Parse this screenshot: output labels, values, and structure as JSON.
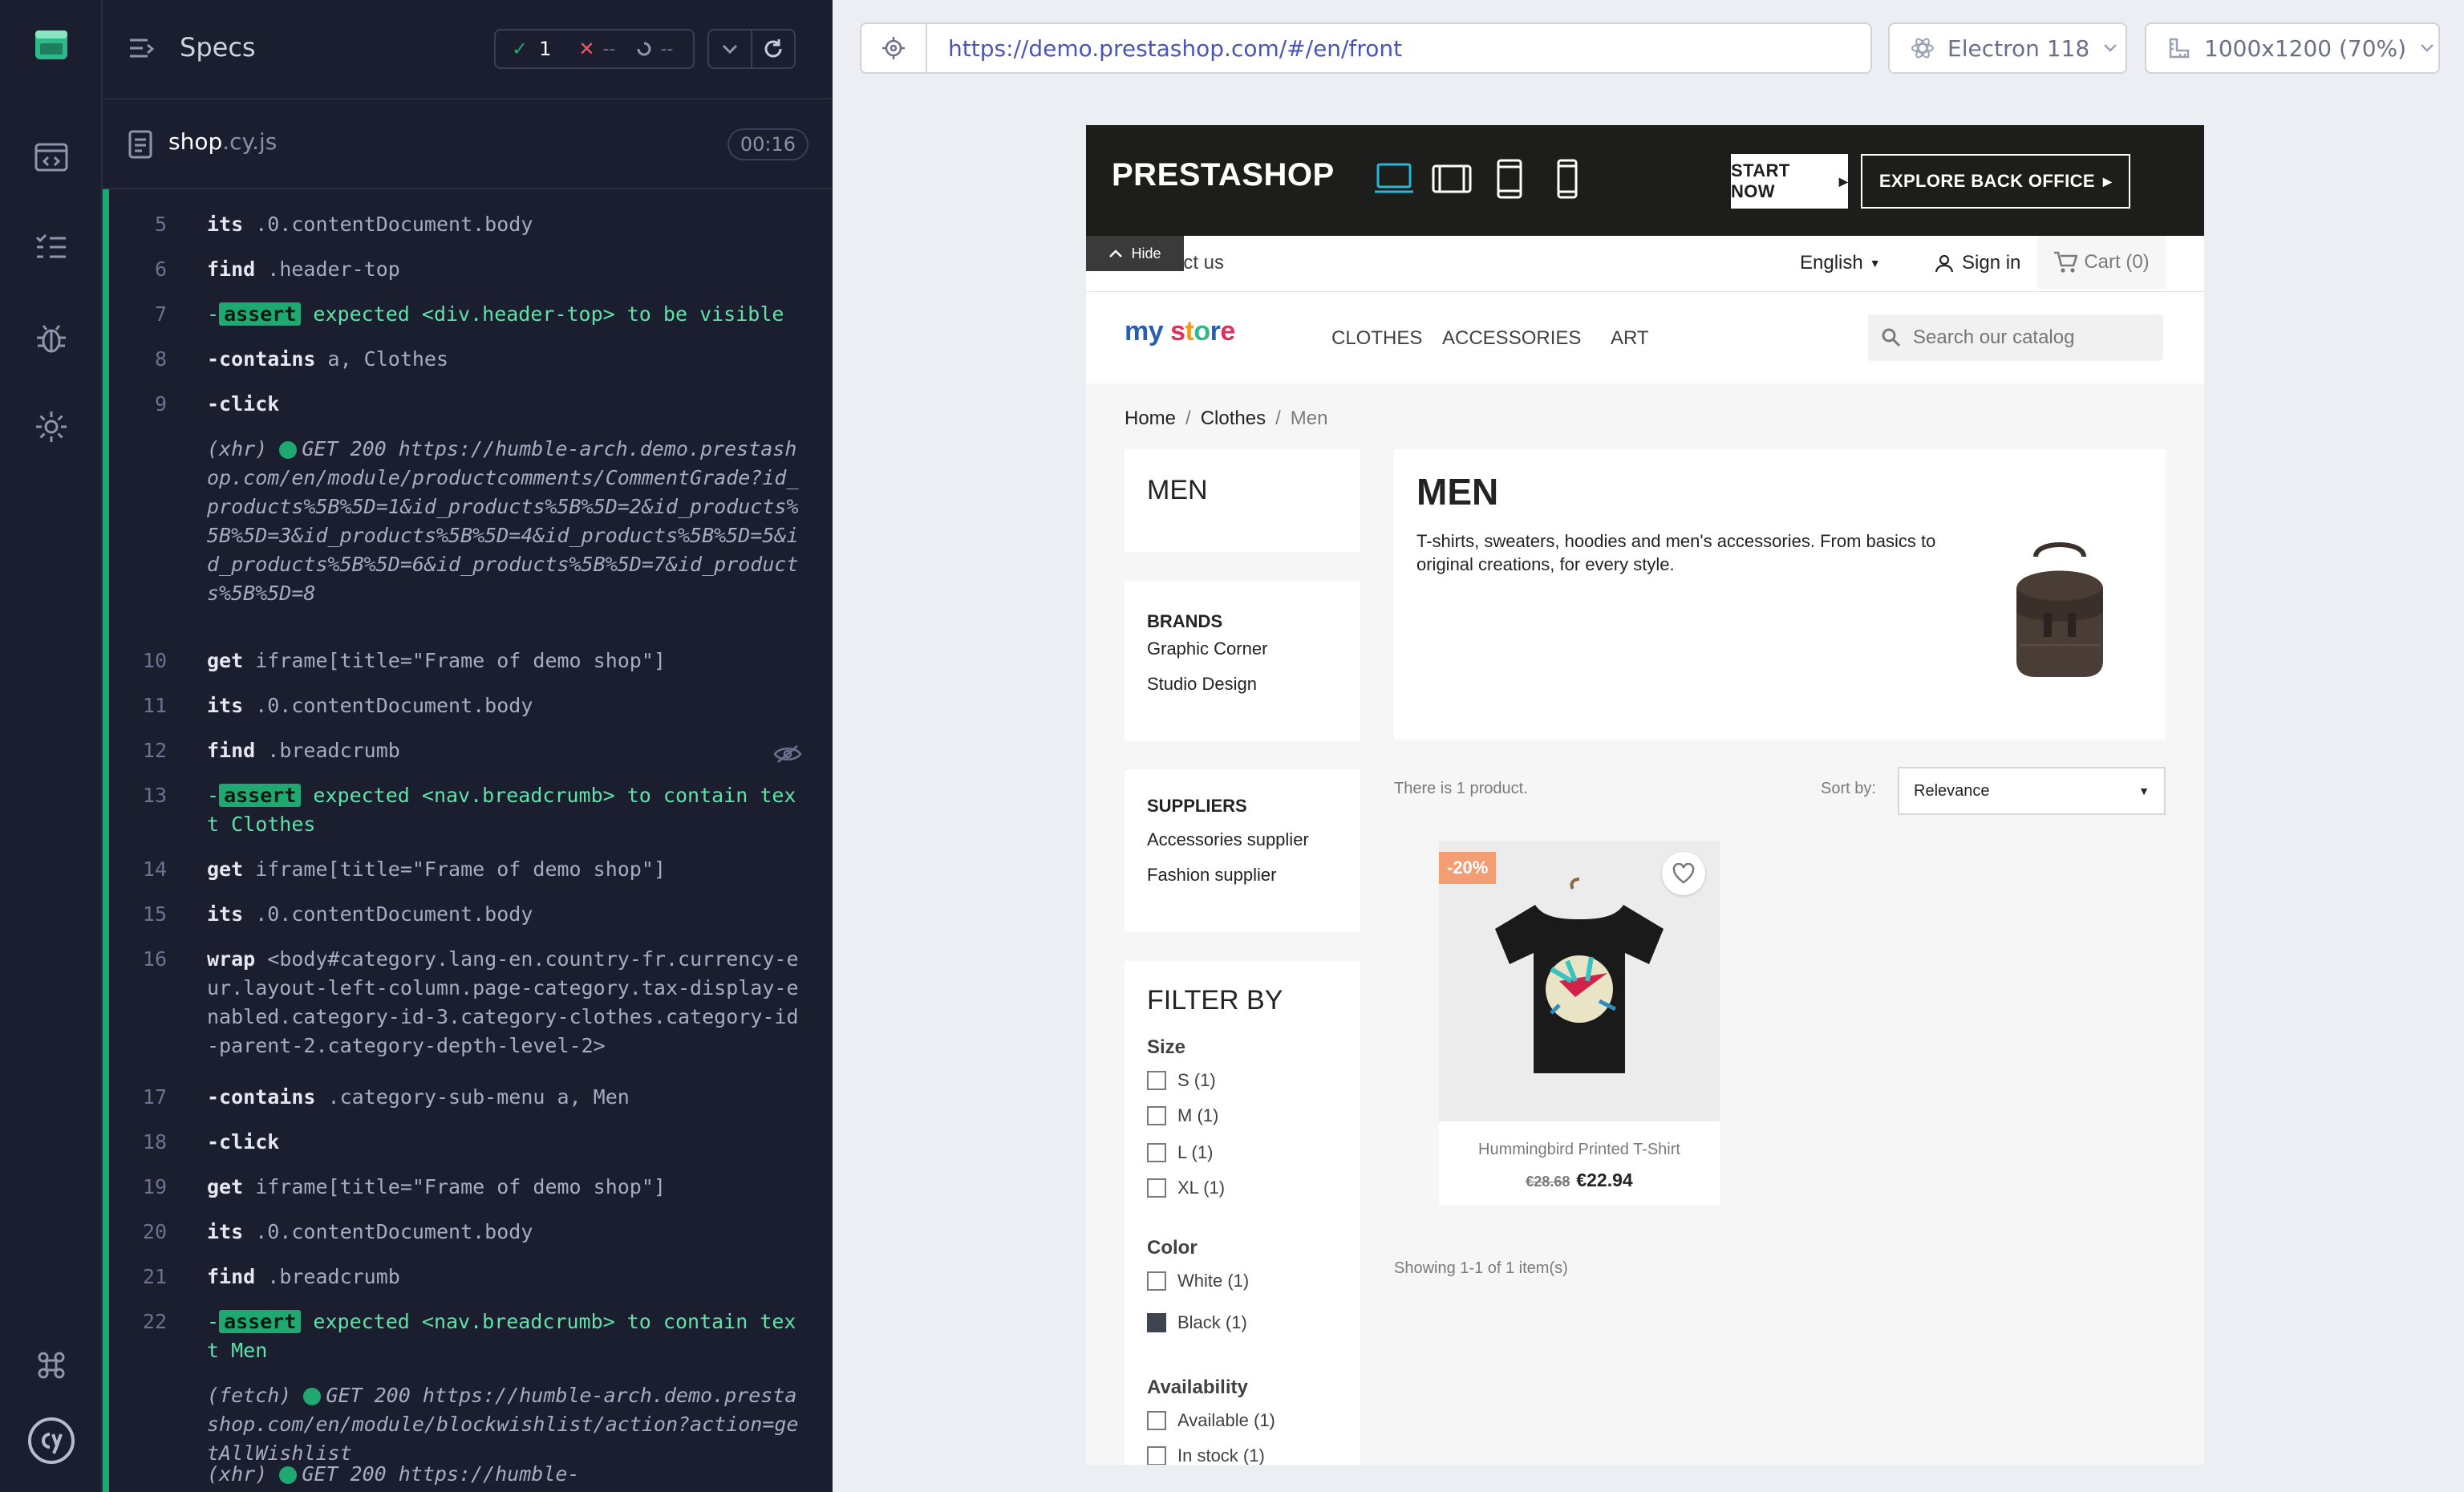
{
  "rail": {
    "items": [
      "app-logo-icon",
      "specs-nav-icon",
      "runs-nav-icon",
      "debug-nav-icon",
      "settings-nav-icon",
      "keyboard-shortcuts-icon",
      "cypress-logo-icon"
    ]
  },
  "reporter": {
    "title": "Specs",
    "passed": "1",
    "failed": "--",
    "pending": "--",
    "spec_name": "shop",
    "spec_ext": ".cy.js",
    "duration": "00:16",
    "commands": [
      {
        "num": "5",
        "name": "its",
        "msg": ".0.contentDocument.body"
      },
      {
        "num": "6",
        "name": "find",
        "msg": ".header-top"
      },
      {
        "num": "7",
        "badge": "assert",
        "text": "expected <div.header-top> to be visible"
      },
      {
        "num": "8",
        "name": "-contains",
        "msg": "a, Clothes"
      },
      {
        "num": "9",
        "name": "-click",
        "msg": ""
      },
      {
        "num": "",
        "xhr_type": "(xhr)",
        "xhr_text": "GET 200 https://humble-arch.demo.prestashop.com/en/module/productcomments/CommentGrade?id_products%5B%5D=1&id_products%5B%5D=2&id_products%5B%5D=3&id_products%5B%5D=4&id_products%5B%5D=5&id_products%5B%5D=6&id_products%5B%5D=7&id_products%5B%5D=8"
      },
      {
        "num": "10",
        "name": "get",
        "msg": "iframe[title=\"Frame of demo shop\"]"
      },
      {
        "num": "11",
        "name": "its",
        "msg": ".0.contentDocument.body"
      },
      {
        "num": "12",
        "name": "find",
        "msg": ".breadcrumb"
      },
      {
        "num": "13",
        "badge": "assert",
        "text": "expected <nav.breadcrumb> to contain text Clothes"
      },
      {
        "num": "14",
        "name": "get",
        "msg": "iframe[title=\"Frame of demo shop\"]"
      },
      {
        "num": "15",
        "name": "its",
        "msg": ".0.contentDocument.body"
      },
      {
        "num": "16",
        "name": "wrap",
        "msg": "<body#category.lang-en.country-fr.currency-eur.layout-left-column.page-category.tax-display-enabled.category-id-3.category-clothes.category-id-parent-2.category-depth-level-2>"
      },
      {
        "num": "17",
        "name": "-contains",
        "msg": ".category-sub-menu a, Men"
      },
      {
        "num": "18",
        "name": "-click",
        "msg": ""
      },
      {
        "num": "19",
        "name": "get",
        "msg": "iframe[title=\"Frame of demo shop\"]"
      },
      {
        "num": "20",
        "name": "its",
        "msg": ".0.contentDocument.body"
      },
      {
        "num": "21",
        "name": "find",
        "msg": ".breadcrumb"
      },
      {
        "num": "22",
        "badge": "assert",
        "text": "expected <nav.breadcrumb> to contain text Men"
      },
      {
        "num": "",
        "xhr_type": "(fetch)",
        "xhr_text": "GET 200 https://humble-arch.demo.prestashop.com/en/module/blockwishlist/action?action=getAllWishlist"
      },
      {
        "num": "",
        "xhr_type": "(xhr)",
        "xhr_text": "GET 200 https://humble-"
      }
    ]
  },
  "browser": {
    "url": "https://demo.prestashop.com/#/en/front",
    "browser_name": "Electron 118",
    "viewport": "1000x1200 (70%)"
  },
  "shop": {
    "banner_logo": "PRESTASHOP",
    "start_now": "START NOW",
    "explore_bo": "EXPLORE BACK OFFICE",
    "hide": "Hide",
    "contact": "act us",
    "language": "English",
    "sign_in": "Sign in",
    "cart": "Cart (0)",
    "logo_text": "my store",
    "nav": [
      "CLOTHES",
      "ACCESSORIES",
      "ART"
    ],
    "search_placeholder": "Search our catalog",
    "breadcrumb": [
      "Home",
      "Clothes",
      "Men"
    ],
    "sidebar_title": "MEN",
    "brands_title": "BRANDS",
    "brands": [
      "Graphic Corner",
      "Studio Design"
    ],
    "suppliers_title": "SUPPLIERS",
    "suppliers": [
      "Accessories supplier",
      "Fashion supplier"
    ],
    "filter_title": "FILTER BY",
    "facets": {
      "size_title": "Size",
      "sizes": [
        "S (1)",
        "M (1)",
        "L (1)",
        "XL (1)"
      ],
      "color_title": "Color",
      "colors": [
        "White (1)",
        "Black (1)"
      ],
      "availability_title": "Availability",
      "availability": [
        "Available (1)",
        "In stock (1)"
      ]
    },
    "category_title": "MEN",
    "category_desc": "T-shirts, sweaters, hoodies and men's accessories. From basics to original creations, for every style.",
    "product_count": "There is 1 product.",
    "sort_label": "Sort by:",
    "sort_value": "Relevance",
    "product": {
      "discount": "-20%",
      "name": "Hummingbird Printed T-Shirt",
      "old_price": "€28.68",
      "price": "€22.94"
    },
    "showing": "Showing 1-1 of 1 item(s)"
  },
  "colors": {
    "pass_green": "#1fa971",
    "url_blue": "#4955b8",
    "discount_orange": "#f39d72"
  }
}
